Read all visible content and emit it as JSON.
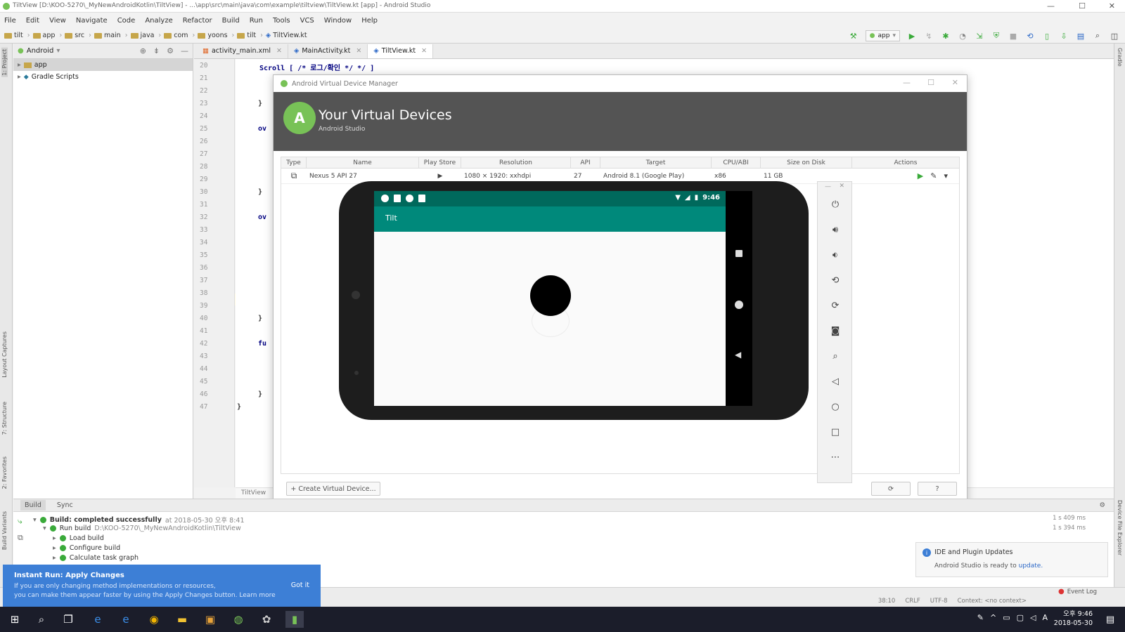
{
  "window": {
    "title": "TiltView [D:\\KOO-5270\\_MyNewAndroidKotlin\\TiltView] - ...\\app\\src\\main\\java\\com\\example\\tiltview\\TiltView.kt [app] - Android Studio"
  },
  "menu": [
    "File",
    "Edit",
    "View",
    "Navigate",
    "Code",
    "Analyze",
    "Refactor",
    "Build",
    "Run",
    "Tools",
    "VCS",
    "Window",
    "Help"
  ],
  "breadcrumbs": [
    "tilt",
    "app",
    "src",
    "main",
    "java",
    "com",
    "yoons",
    "tilt",
    "TiltView.kt"
  ],
  "toolbar": {
    "run_config": "app"
  },
  "project_panel": {
    "selector": "Android",
    "tree": [
      {
        "label": "app",
        "selected": true
      },
      {
        "label": "Gradle Scripts",
        "selected": false
      }
    ]
  },
  "tabs": [
    {
      "label": "activity_main.xml",
      "active": false
    },
    {
      "label": "MainActivity.kt",
      "active": false
    },
    {
      "label": "TiltView.kt",
      "active": true
    }
  ],
  "editor": {
    "line_numbers": [
      "20",
      "21",
      "22",
      "23",
      "24",
      "25",
      "26",
      "27",
      "28",
      "29",
      "30",
      "31",
      "32",
      "33",
      "34",
      "35",
      "36",
      "37",
      "38",
      "39",
      "40",
      "41",
      "42",
      "43",
      "44",
      "45",
      "46",
      "47"
    ],
    "top_line": "Scroll [ /* 로그/확인 */ */ ]",
    "footer_label": "TiltView"
  },
  "avd": {
    "dialog_title": "Android Virtual Device Manager",
    "heading": "Your Virtual Devices",
    "subheading": "Android Studio",
    "columns": [
      "Type",
      "Name",
      "Play Store",
      "Resolution",
      "API",
      "Target",
      "CPU/ABI",
      "Size on Disk",
      "Actions"
    ],
    "device": {
      "name": "Nexus 5 API 27",
      "resolution": "1080 × 1920: xxhdpi",
      "api": "27",
      "target": "Android 8.1 (Google Play)",
      "cpu": "x86",
      "size": "11 GB"
    },
    "create_button": "+ Create Virtual Device...",
    "help_button": "?"
  },
  "emulator": {
    "status_time": "9:46",
    "app_title": "Tilt"
  },
  "build_panel": {
    "tabs": [
      "Build",
      "Sync"
    ],
    "lines": [
      {
        "text": "Build: completed successfully",
        "meta": "at 2018-05-30 오후 8:41",
        "ms": "1 s 409 ms"
      },
      {
        "text": "Run build",
        "meta": "D:\\KOO-5270\\_MyNewAndroidKotlin\\TiltView",
        "ms": "1 s 394 ms"
      },
      {
        "text": "Load build",
        "meta": "",
        "ms": ""
      },
      {
        "text": "Configure build",
        "meta": "",
        "ms": ""
      },
      {
        "text": "Calculate task graph",
        "meta": "",
        "ms": ""
      }
    ]
  },
  "instant_run": {
    "title": "Instant Run: Apply Changes",
    "line1": "If you are only changing method implementations or resources,",
    "line2": "you can make them appear faster by using the Apply Changes button. Learn more",
    "action": "Got it"
  },
  "update_balloon": {
    "title": "IDE and Plugin Updates",
    "body": "Android Studio is ready to",
    "link": "update."
  },
  "statusbar": {
    "event_log": "Event Log",
    "position": "38:10",
    "line_sep": "CRLF",
    "encoding": "UTF-8",
    "context": "Context: <no context>"
  },
  "taskbar": {
    "time": "오후 9:46",
    "date": "2018-05-30",
    "lang": "A"
  },
  "colors": {
    "android_green": "#78c257",
    "app_teal": "#00897b",
    "status_teal": "#00695c",
    "balloon_blue": "#3d7fd6"
  }
}
